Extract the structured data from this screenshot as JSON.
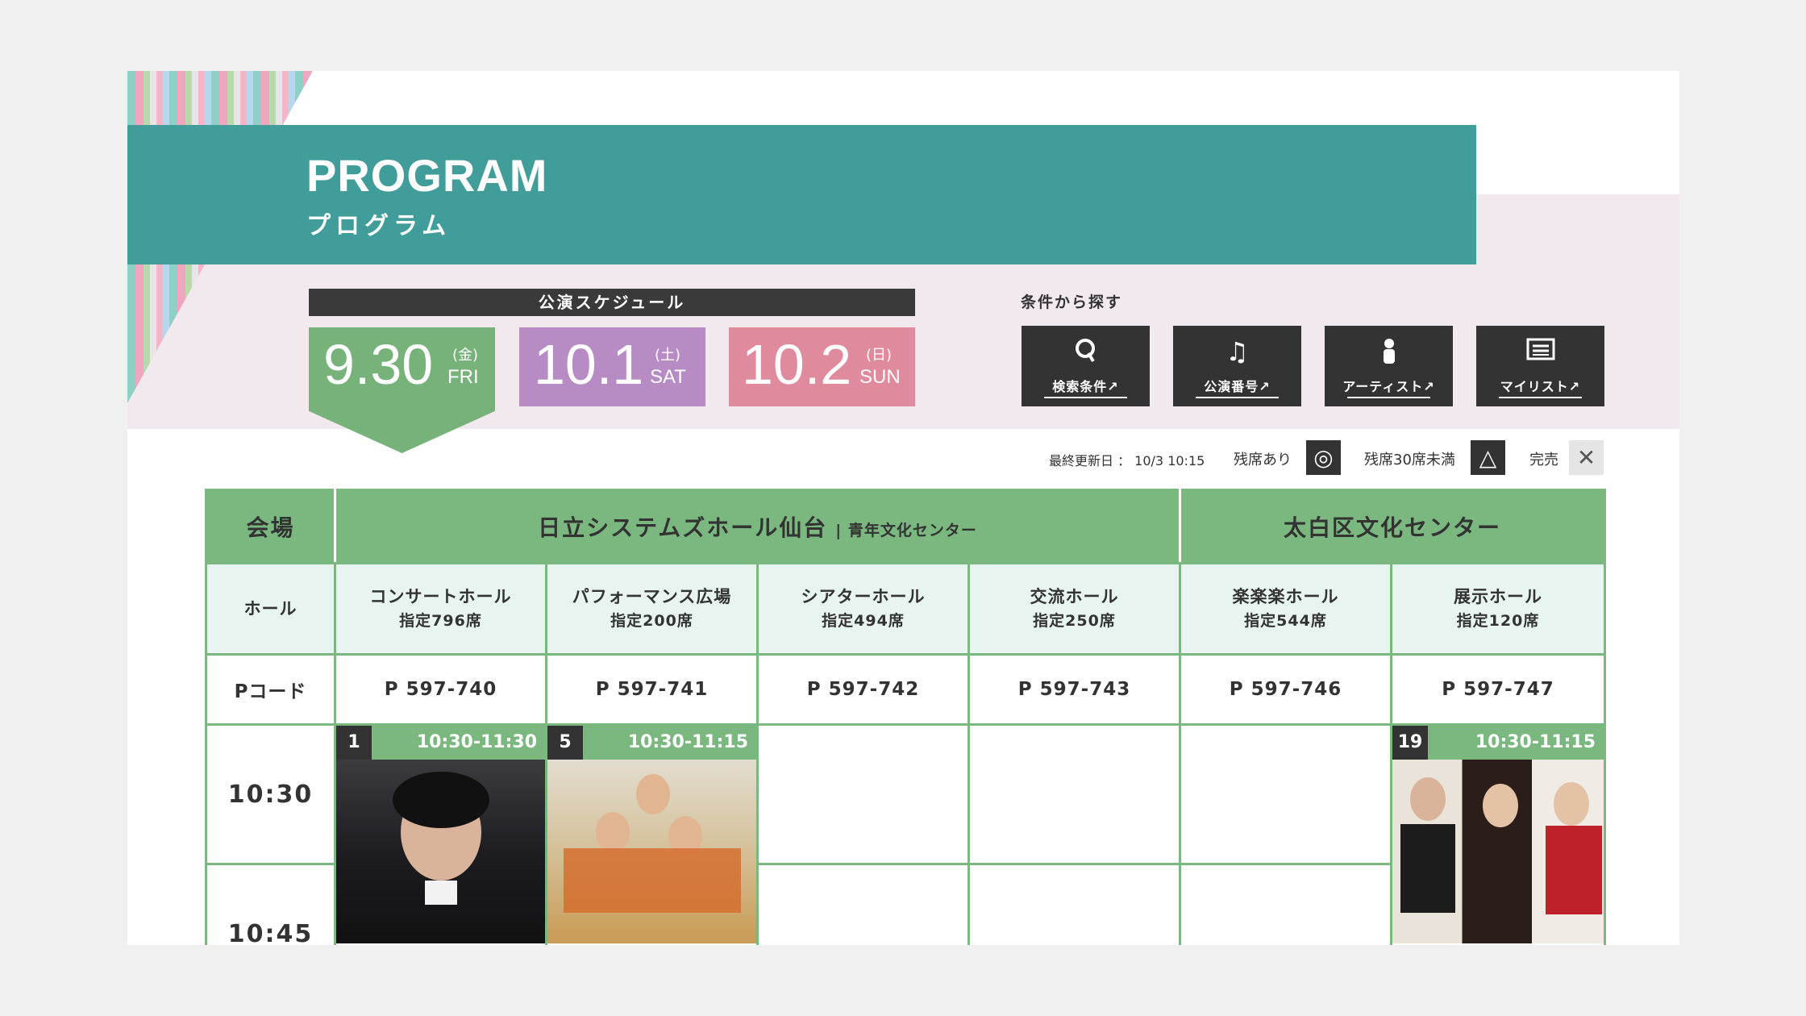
{
  "header": {
    "title_en": "PROGRAM",
    "title_ja": "プログラム"
  },
  "schedule": {
    "label": "公演スケジュール",
    "dates": [
      {
        "num": "9.30",
        "dow_ja": "(金)",
        "dow_en": "FRI",
        "color": "#76b27a",
        "active": true
      },
      {
        "num": "10.1",
        "dow_ja": "(土)",
        "dow_en": "SAT",
        "color": "#b78bc3"
      },
      {
        "num": "10.2",
        "dow_ja": "(日)",
        "dow_en": "SUN",
        "color": "#e08a9d"
      }
    ]
  },
  "search": {
    "label": "条件から探す",
    "buttons": [
      {
        "icon": "search-icon",
        "label": "検索条件↗"
      },
      {
        "icon": "music-note-icon",
        "label": "公演番号↗"
      },
      {
        "icon": "person-icon",
        "label": "アーティスト↗"
      },
      {
        "icon": "list-icon",
        "label": "マイリスト↗"
      }
    ]
  },
  "legend": {
    "updated_label": "最終更新日 ： 10/3 10:15",
    "available": "残席あり",
    "few": "残席30席未満",
    "soldout": "完売",
    "available_icon": "◎",
    "few_icon": "△",
    "soldout_icon": "✕"
  },
  "table": {
    "venue_header": "会場",
    "venues": [
      {
        "name": "日立システムズホール仙台",
        "sub": "青年文化センター"
      },
      {
        "name": "太白区文化センター",
        "sub": ""
      }
    ],
    "hall_header": "ホール",
    "halls": [
      {
        "name": "コンサートホール",
        "cap": "指定796席"
      },
      {
        "name": "パフォーマンス広場",
        "cap": "指定200席"
      },
      {
        "name": "シアターホール",
        "cap": "指定494席"
      },
      {
        "name": "交流ホール",
        "cap": "指定250席"
      },
      {
        "name": "楽楽楽ホール",
        "cap": "指定544席"
      },
      {
        "name": "展示ホール",
        "cap": "指定120席"
      }
    ],
    "code_header": "Pコード",
    "codes": [
      "P 597-740",
      "P 597-741",
      "P 597-742",
      "P 597-743",
      "P 597-746",
      "P 597-747"
    ],
    "times": [
      "10:30",
      "10:45"
    ],
    "events": [
      {
        "no": "1",
        "time": "10:30-11:30"
      },
      {
        "no": "5",
        "time": "10:30-11:15"
      },
      {
        "no": "19",
        "time": "10:30-11:15"
      }
    ]
  }
}
